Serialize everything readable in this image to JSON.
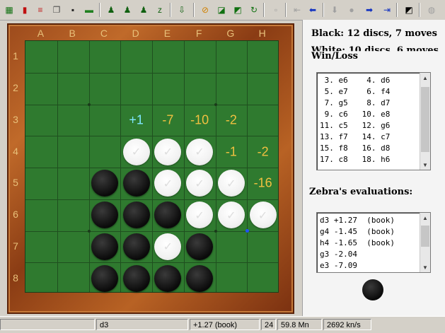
{
  "toolbar": {
    "buttons": [
      {
        "name": "new-game",
        "icon": "grid-icon",
        "color": "#107010"
      },
      {
        "name": "open",
        "icon": "red-book-icon",
        "color": "#c01010"
      },
      {
        "name": "books",
        "icon": "books-icon",
        "color": "#c02020"
      },
      {
        "name": "copy",
        "icon": "copy-icon",
        "color": "#505050"
      },
      {
        "name": "save",
        "icon": "floppy-icon",
        "color": "#202020"
      },
      {
        "name": "folder",
        "icon": "folder-icon",
        "color": "#208020"
      },
      {
        "name": "hint",
        "icon": "player-up-icon",
        "color": "#106010"
      },
      {
        "name": "setup",
        "icon": "player-icon",
        "color": "#106010"
      },
      {
        "name": "analyze",
        "icon": "player-gear-icon",
        "color": "#106010"
      },
      {
        "name": "sleep",
        "icon": "zzz-icon",
        "color": "#106010"
      },
      {
        "name": "download",
        "icon": "download-icon",
        "color": "#106010"
      },
      {
        "name": "stop",
        "icon": "no-sign-icon",
        "color": "#d08000"
      },
      {
        "name": "expand",
        "icon": "expand-icon",
        "color": "#107010"
      },
      {
        "name": "shrink",
        "icon": "shrink-icon",
        "color": "#107010"
      },
      {
        "name": "refresh",
        "icon": "refresh-icon",
        "color": "#107010"
      },
      {
        "name": "blank",
        "icon": "blank-icon",
        "color": "#a0a0a0"
      },
      {
        "name": "first",
        "icon": "first-icon",
        "color": "#a0a0a0"
      },
      {
        "name": "back",
        "icon": "back-arrow-icon",
        "color": "#1030c0"
      },
      {
        "name": "down",
        "icon": "down-arrow-icon",
        "color": "#a0a0a0"
      },
      {
        "name": "bulb",
        "icon": "bulb-icon",
        "color": "#a0a0a0"
      },
      {
        "name": "forward",
        "icon": "forward-arrow-icon",
        "color": "#1030c0"
      },
      {
        "name": "last",
        "icon": "last-icon",
        "color": "#1030c0"
      },
      {
        "name": "invert",
        "icon": "invert-icon",
        "color": "#000000"
      },
      {
        "name": "globe",
        "icon": "globe-icon",
        "color": "#a0a0a0"
      }
    ]
  },
  "board": {
    "columns": [
      "A",
      "B",
      "C",
      "D",
      "E",
      "F",
      "G",
      "H"
    ],
    "rows": [
      "1",
      "2",
      "3",
      "4",
      "5",
      "6",
      "7",
      "8"
    ],
    "discs": [
      {
        "square": "d4",
        "color": "white"
      },
      {
        "square": "e4",
        "color": "white"
      },
      {
        "square": "f4",
        "color": "white"
      },
      {
        "square": "c5",
        "color": "black"
      },
      {
        "square": "d5",
        "color": "black"
      },
      {
        "square": "e5",
        "color": "white"
      },
      {
        "square": "f5",
        "color": "white"
      },
      {
        "square": "g5",
        "color": "white"
      },
      {
        "square": "c6",
        "color": "black"
      },
      {
        "square": "d6",
        "color": "black"
      },
      {
        "square": "e6",
        "color": "black"
      },
      {
        "square": "f6",
        "color": "white"
      },
      {
        "square": "g6",
        "color": "white"
      },
      {
        "square": "h6",
        "color": "white"
      },
      {
        "square": "c7",
        "color": "black"
      },
      {
        "square": "d7",
        "color": "black"
      },
      {
        "square": "e7",
        "color": "white"
      },
      {
        "square": "f7",
        "color": "black"
      },
      {
        "square": "c8",
        "color": "black"
      },
      {
        "square": "d8",
        "color": "black"
      },
      {
        "square": "e8",
        "color": "black"
      },
      {
        "square": "f8",
        "color": "black"
      }
    ],
    "evaluations": [
      {
        "square": "d3",
        "value": "+1",
        "best": true
      },
      {
        "square": "e3",
        "value": "-7",
        "best": false
      },
      {
        "square": "f3",
        "value": "-10",
        "best": false
      },
      {
        "square": "g3",
        "value": "-2",
        "best": false
      },
      {
        "square": "g4",
        "value": "-1",
        "best": false
      },
      {
        "square": "h4",
        "value": "-2",
        "best": false
      },
      {
        "square": "h5",
        "value": "-16",
        "best": false
      }
    ],
    "last_move_square": "h6",
    "colors": {
      "board": "#2f7a2f",
      "eval": "#f0c040",
      "best_eval": "#7fe7ff"
    }
  },
  "side_panel": {
    "black_line": "Black:   12 discs, 7 moves",
    "white_line": "White:   10 discs, 6 moves",
    "win_loss_label": "Win/Loss",
    "moves": [
      "3. e6    4. d6",
      "5. e7    6. f4",
      "7. g5    8. d7",
      "9. c6   10. e8",
      "11. c5   12. g6",
      "13. f7   14. c7",
      "15. f8   16. d8",
      "17. c8   18. h6"
    ],
    "evals_title": "Zebra's evaluations:",
    "evals": [
      "d3 +1.27  (book)",
      "g4 -1.45  (book)",
      "h4 -1.65  (book)",
      "g3 -2.04",
      "e3 -7.09"
    ],
    "side_to_move": "black"
  },
  "status": {
    "cells": [
      "",
      "d3",
      "+1.27 (book)",
      "24",
      "59.8 Mn",
      "2692 kn/s"
    ]
  }
}
